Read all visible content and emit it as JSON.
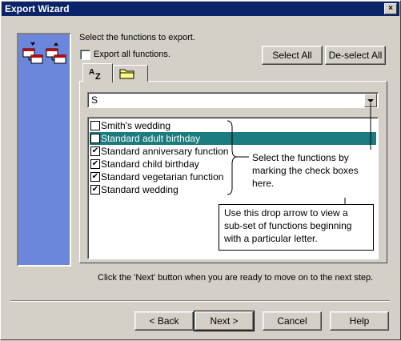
{
  "window": {
    "title": "Export Wizard",
    "close_glyph": "×"
  },
  "instructions": "Select the functions to export.",
  "export_all_label": "Export all functions.",
  "buttons": {
    "select_all": "Select All",
    "deselect_all": "De-select All",
    "back": "< Back",
    "next": "Next >",
    "cancel": "Cancel",
    "help": "Help"
  },
  "tabs": [
    {
      "name": "alphabetical-tab",
      "icon": "az-sort-icon",
      "label": "AZ"
    },
    {
      "name": "folder-tab",
      "icon": "folder-icon",
      "label": ""
    }
  ],
  "letter_filter": {
    "value": "S"
  },
  "functions": [
    {
      "label": "Smith's wedding",
      "checked": false,
      "selected": false
    },
    {
      "label": "Standard adult birthday",
      "checked": true,
      "selected": true
    },
    {
      "label": "Standard anniversary function",
      "checked": true,
      "selected": false
    },
    {
      "label": "Standard child birthday",
      "checked": true,
      "selected": false
    },
    {
      "label": "Standard vegetarian function",
      "checked": true,
      "selected": false
    },
    {
      "label": "Standard wedding",
      "checked": true,
      "selected": false
    }
  ],
  "callouts": {
    "check_boxes": "Select the functions by marking the check boxes here.",
    "drop_arrow": "Use this drop arrow to view a sub-set of functions beginning with a particular letter."
  },
  "footer_hint": "Click the 'Next' button when you are ready to move on to the next step.",
  "colors": {
    "title_bar": "#0a246a",
    "side_panel": "#6b86da",
    "selection": "#1b7b7e"
  }
}
